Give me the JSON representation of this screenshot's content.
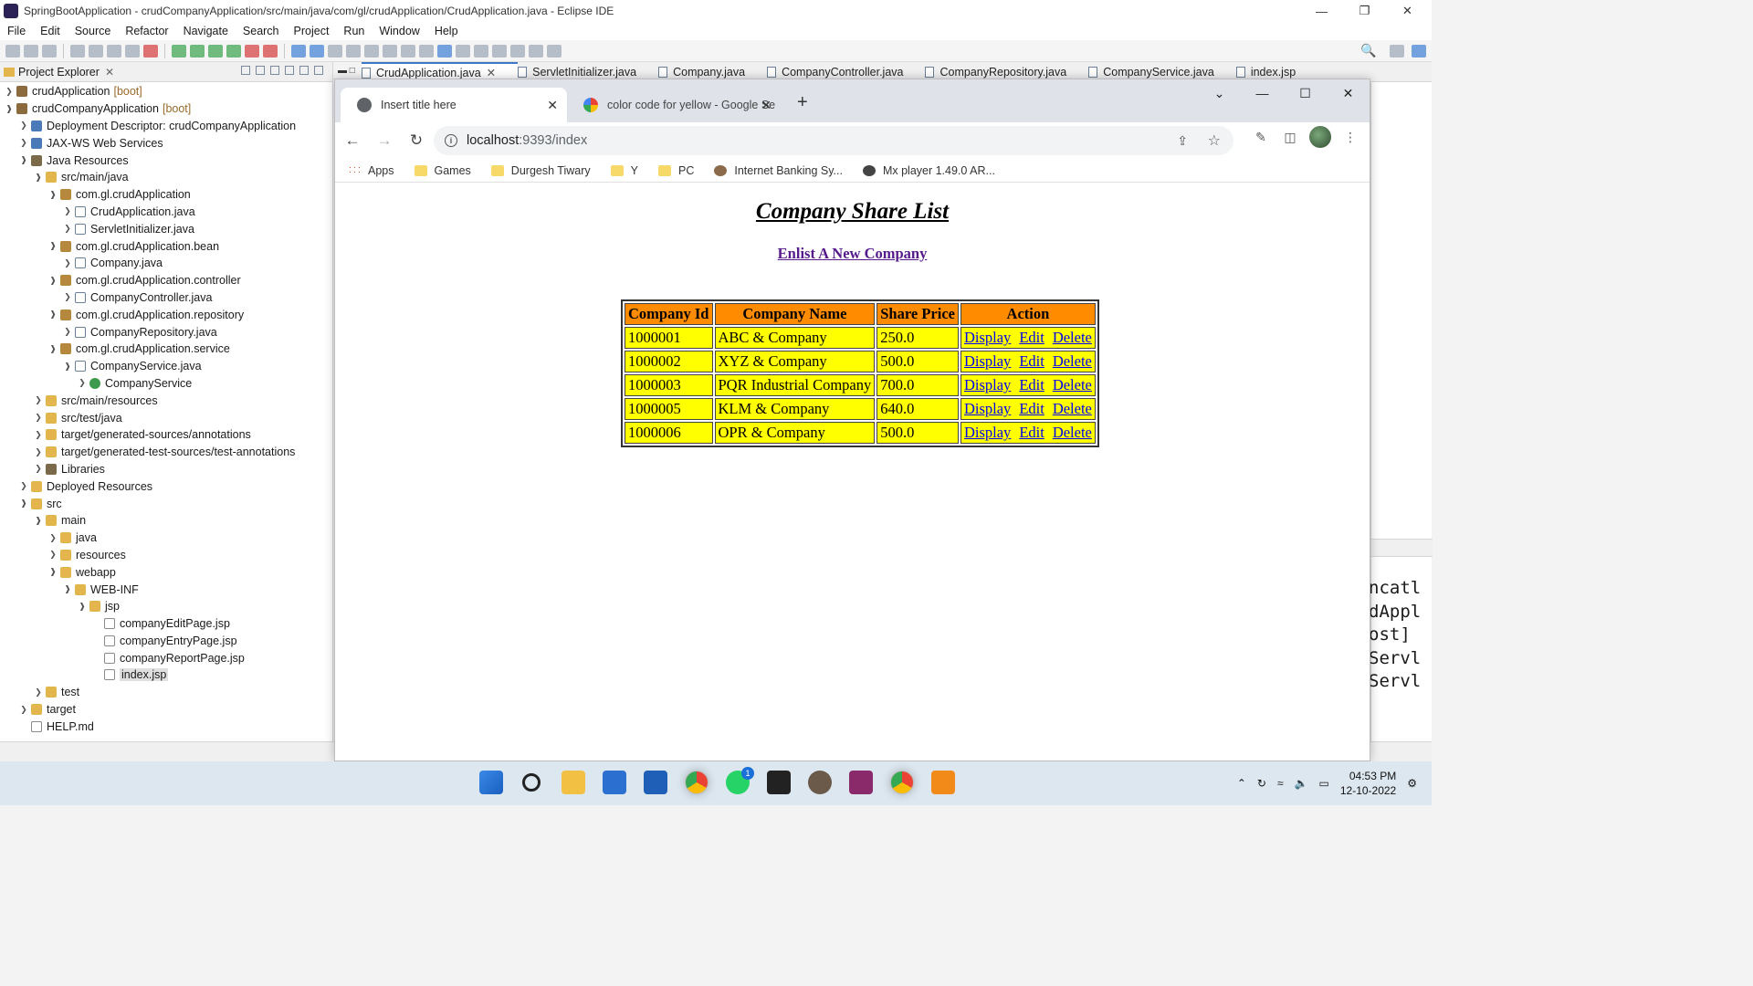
{
  "window": {
    "title": "SpringBootApplication - crudCompanyApplication/src/main/java/com/gl/crudApplication/CrudApplication.java - Eclipse IDE"
  },
  "menu": [
    "File",
    "Edit",
    "Source",
    "Refactor",
    "Navigate",
    "Search",
    "Project",
    "Run",
    "Window",
    "Help"
  ],
  "explorer": {
    "tab_label": "Project Explorer",
    "items": [
      {
        "label": "crudApplication",
        "tag": "[boot]"
      },
      {
        "label": "crudCompanyApplication",
        "tag": "[boot]"
      },
      {
        "label": "Deployment Descriptor: crudCompanyApplication",
        "tag": ""
      },
      {
        "label": "JAX-WS Web Services",
        "tag": ""
      },
      {
        "label": "Java Resources",
        "tag": ""
      },
      {
        "label": "src/main/java",
        "tag": ""
      },
      {
        "label": "com.gl.crudApplication",
        "tag": ""
      },
      {
        "label": "CrudApplication.java",
        "tag": ""
      },
      {
        "label": "ServletInitializer.java",
        "tag": ""
      },
      {
        "label": "com.gl.crudApplication.bean",
        "tag": ""
      },
      {
        "label": "Company.java",
        "tag": ""
      },
      {
        "label": "com.gl.crudApplication.controller",
        "tag": ""
      },
      {
        "label": "CompanyController.java",
        "tag": ""
      },
      {
        "label": "com.gl.crudApplication.repository",
        "tag": ""
      },
      {
        "label": "CompanyRepository.java",
        "tag": ""
      },
      {
        "label": "com.gl.crudApplication.service",
        "tag": ""
      },
      {
        "label": "CompanyService.java",
        "tag": ""
      },
      {
        "label": "CompanyService",
        "tag": ""
      },
      {
        "label": "src/main/resources",
        "tag": ""
      },
      {
        "label": "src/test/java",
        "tag": ""
      },
      {
        "label": "target/generated-sources/annotations",
        "tag": ""
      },
      {
        "label": "target/generated-test-sources/test-annotations",
        "tag": ""
      },
      {
        "label": "Libraries",
        "tag": ""
      },
      {
        "label": "Deployed Resources",
        "tag": ""
      },
      {
        "label": "src",
        "tag": ""
      },
      {
        "label": "main",
        "tag": ""
      },
      {
        "label": "java",
        "tag": ""
      },
      {
        "label": "resources",
        "tag": ""
      },
      {
        "label": "webapp",
        "tag": ""
      },
      {
        "label": "WEB-INF",
        "tag": ""
      },
      {
        "label": "jsp",
        "tag": ""
      },
      {
        "label": "companyEditPage.jsp",
        "tag": ""
      },
      {
        "label": "companyEntryPage.jsp",
        "tag": ""
      },
      {
        "label": "companyReportPage.jsp",
        "tag": ""
      },
      {
        "label": "index.jsp",
        "tag": ""
      },
      {
        "label": "test",
        "tag": ""
      },
      {
        "label": "target",
        "tag": ""
      },
      {
        "label": "HELP.md",
        "tag": ""
      }
    ]
  },
  "editor_tabs": [
    "CrudApplication.java",
    "ServletInitializer.java",
    "Company.java",
    "CompanyController.java",
    "CompanyRepository.java",
    "CompanyService.java",
    "index.jsp"
  ],
  "console_snippet": [
    "ncatl",
    "dAppl",
    "ost]",
    "Servl",
    "Servl"
  ],
  "browser": {
    "tabs": [
      {
        "title": "Insert title here"
      },
      {
        "title": "color code for yellow - Google Se"
      }
    ],
    "url_host": "localhost",
    "url_path": ":9393/index",
    "bookmarks": [
      "Apps",
      "Games",
      "Durgesh Tiwary",
      "Y",
      "PC",
      "Internet Banking Sy...",
      "Mx player 1.49.0 AR..."
    ]
  },
  "page": {
    "heading": "Company Share List",
    "enlist_link": "Enlist A New Company",
    "table": {
      "headers": [
        "Company Id",
        "Company Name",
        "Share Price",
        "Action"
      ],
      "actions": [
        "Display",
        "Edit",
        "Delete"
      ],
      "rows": [
        {
          "id": "1000001",
          "name": "ABC & Company",
          "price": "250.0"
        },
        {
          "id": "1000002",
          "name": "XYZ & Company",
          "price": "500.0"
        },
        {
          "id": "1000003",
          "name": "PQR Industrial Company",
          "price": "700.0"
        },
        {
          "id": "1000005",
          "name": "KLM & Company",
          "price": "640.0"
        },
        {
          "id": "1000006",
          "name": "OPR & Company",
          "price": "500.0"
        }
      ]
    }
  },
  "taskbar": {
    "whatsapp_badge": "1",
    "time": "04:53 PM",
    "date": "12-10-2022"
  }
}
